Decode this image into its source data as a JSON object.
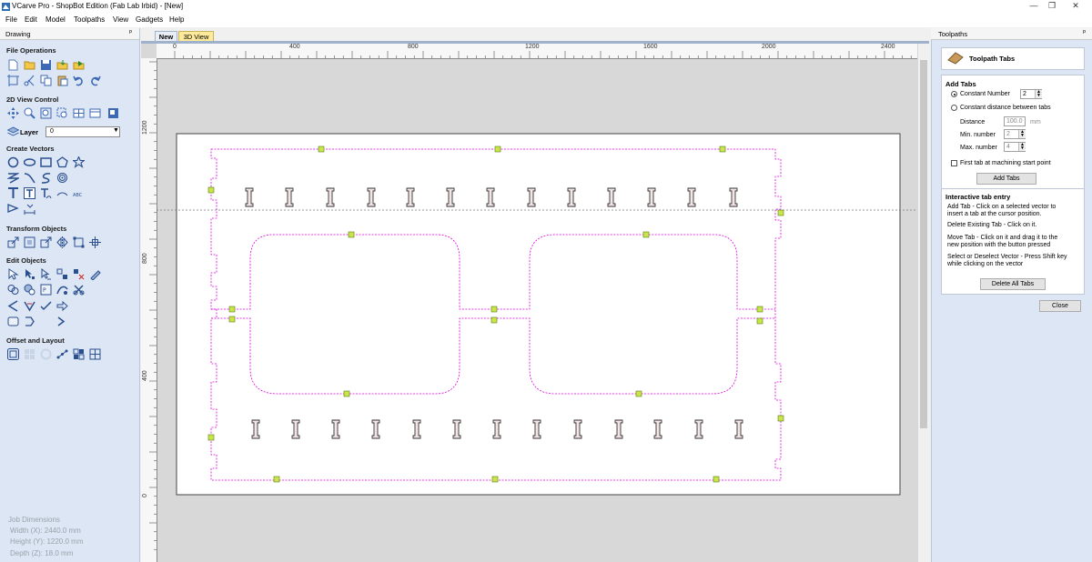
{
  "window": {
    "title": "VCarve Pro - ShopBot Edition (Fab Lab Irbid) - [New]",
    "controls": {
      "minimize": "—",
      "restore": "❐",
      "close": "✕"
    }
  },
  "menu": [
    "File",
    "Edit",
    "Model",
    "Toolpaths",
    "View",
    "Gadgets",
    "Help"
  ],
  "left_panel": {
    "header": "Drawing",
    "pin": "ᵖ",
    "sections": {
      "file_ops": "File Operations",
      "view_control": "2D View Control",
      "create_vectors": "Create Vectors",
      "transform": "Transform Objects",
      "edit": "Edit Objects",
      "offset": "Offset and Layout"
    },
    "layer_label": "Layer",
    "layer_value": "0",
    "job_dimensions": {
      "title": "Job Dimensions",
      "width": "Width  (X): 2440.0 mm",
      "height": "Height (Y): 1220.0 mm",
      "depth": "Depth  (Z): 18.0 mm"
    }
  },
  "tabs": {
    "new": "New",
    "view3d": "3D View"
  },
  "rulers": {
    "h_labels": [
      "0",
      "400",
      "800",
      "1200",
      "1600",
      "2000",
      "2400"
    ],
    "v_labels": [
      "1200",
      "800",
      "400",
      "0"
    ]
  },
  "right_panel": {
    "header": "Toolpaths",
    "pin": "ᵖ",
    "title": "Toolpath Tabs",
    "add_tabs_heading": "Add Tabs",
    "constant_number_label": "Constant Number",
    "constant_number_value": "2",
    "constant_distance_label": "Constant distance between tabs",
    "distance_label": "Distance",
    "distance_value": "100.0",
    "distance_unit": "mm",
    "min_label": "Min. number",
    "min_value": "2",
    "max_label": "Max. number",
    "max_value": "4",
    "first_tab_label": "First tab at machining start point",
    "add_tabs_button": "Add Tabs",
    "interactive_heading": "Interactive tab entry",
    "help_add_1": "Add Tab - Click on a selected vector to",
    "help_add_2": "insert a tab at the cursor position.",
    "help_delete": "Delete Existing Tab - Click on it.",
    "help_move_1": "Move Tab - Click on it and drag it to the",
    "help_move_2": "new position with the button pressed",
    "help_select_1": "Select or Deselect Vector - Press Shift key",
    "help_select_2": "while clicking on the vector",
    "delete_all_button": "Delete All Tabs",
    "close_button": "Close"
  },
  "colors": {
    "accent": "#e000e0",
    "tab_marker": "#c8e64a",
    "panel": "#dce6f4"
  }
}
